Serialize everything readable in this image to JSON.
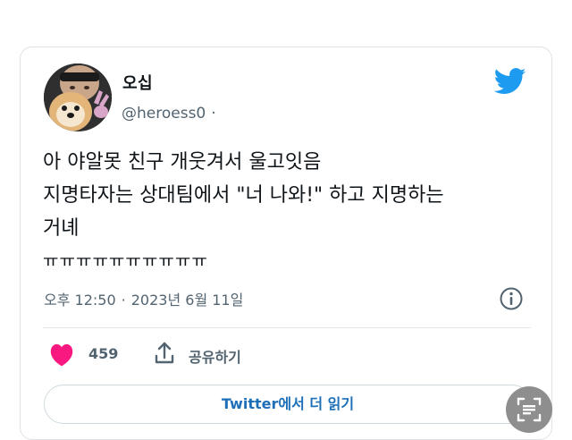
{
  "tweet": {
    "author": {
      "name": "오십",
      "handle": "@heroess0",
      "separator": "·"
    },
    "text_lines": [
      "아 야알못 친구 개웃겨서 울고잇음",
      "지명타자는 상대팀에서 \"너 나와!\" 하고 지명하는",
      "거녜",
      "ㅠㅠㅠㅠㅠㅠㅠㅠㅠㅠ"
    ],
    "time": "오후 12:50",
    "meta_separator": "·",
    "date": "2023년 6월 11일",
    "likes": "459",
    "share_label": "공유하기",
    "read_more_label": "Twitter에서 더 읽기"
  },
  "colors": {
    "brand_blue": "#1d9bf0",
    "heart_pink": "#f91880",
    "secondary_text": "#536471"
  },
  "icons": {
    "logo": "twitter-bird-icon",
    "info": "info-icon",
    "like": "heart-icon",
    "share": "share-upload-icon",
    "scan": "scan-text-icon"
  }
}
